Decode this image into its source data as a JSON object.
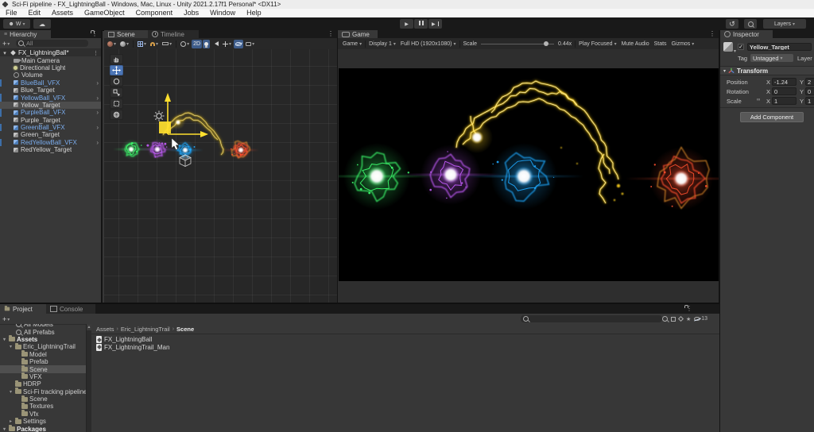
{
  "window": {
    "title": "Sci-Fi pipeline - FX_LightningBall - Windows, Mac, Linux - Unity 2021.2.17f1 Personal* <DX11>",
    "menu_items": [
      "File",
      "Edit",
      "Assets",
      "GameObject",
      "Component",
      "Jobs",
      "Window",
      "Help"
    ]
  },
  "toolbar": {
    "account_initial": "W",
    "layers_label": "Layers"
  },
  "hierarchy": {
    "tab_label": "Hierarchy",
    "search_text": "All",
    "items": [
      {
        "label": "FX_LightningBall*",
        "kind": "scene",
        "indent": 0
      },
      {
        "label": "Main Camera",
        "kind": "camera",
        "indent": 1
      },
      {
        "label": "Directional Light",
        "kind": "light",
        "indent": 1
      },
      {
        "label": "Volume",
        "kind": "volume",
        "indent": 1
      },
      {
        "label": "BlueBall_VFX",
        "kind": "prefab",
        "indent": 1,
        "chevron": true
      },
      {
        "label": "Blue_Target",
        "kind": "object",
        "indent": 1
      },
      {
        "label": "YellowBall_VFX",
        "kind": "prefab",
        "indent": 1,
        "chevron": true
      },
      {
        "label": "Yellow_Target",
        "kind": "object",
        "indent": 1,
        "selected": true
      },
      {
        "label": "PurpleBall_VFX",
        "kind": "prefab",
        "indent": 1,
        "chevron": true
      },
      {
        "label": "Purple_Target",
        "kind": "object",
        "indent": 1
      },
      {
        "label": "GreenBall_VFX",
        "kind": "prefab",
        "indent": 1,
        "chevron": true
      },
      {
        "label": "Green_Target",
        "kind": "object",
        "indent": 1
      },
      {
        "label": "RedYellowBall_VFX",
        "kind": "prefab",
        "indent": 1,
        "chevron": true
      },
      {
        "label": "RedYellow_Target",
        "kind": "object",
        "indent": 1
      }
    ]
  },
  "scene_panel": {
    "tabs": [
      {
        "label": "Scene"
      },
      {
        "label": "Timeline"
      }
    ],
    "mode_2d_label": "2D"
  },
  "game_panel": {
    "tab_label": "Game",
    "controls": {
      "mode": "Game",
      "display": "Display 1",
      "resolution": "Full HD (1920x1080)",
      "scale_label": "Scale",
      "scale_value": "0.44x",
      "play_focused": "Play Focused",
      "mute_audio": "Mute Audio",
      "stats": "Stats",
      "gizmos": "Gizmos"
    }
  },
  "inspector": {
    "tab_label": "Inspector",
    "object_name": "Yellow_Target",
    "tag_label": "Tag",
    "tag_value": "Untagged",
    "layer_label": "Layer",
    "transform_title": "Transform",
    "axis_x": "X",
    "axis_y": "Y",
    "rows": [
      {
        "label": "Position",
        "x": "-1.24",
        "y": "2"
      },
      {
        "label": "Rotation",
        "x": "0",
        "y": "0"
      },
      {
        "label": "Scale",
        "x": "1",
        "y": "1",
        "linked": true
      }
    ],
    "add_component_label": "Add Component"
  },
  "project": {
    "tab_label": "Project",
    "console_tab_label": "Console",
    "hidden_count": "13",
    "tree": [
      {
        "label": "All Models",
        "kind": "query",
        "indent": 1
      },
      {
        "label": "All Prefabs",
        "kind": "query",
        "indent": 1
      },
      {
        "label": "Assets",
        "kind": "folder",
        "indent": 0,
        "arrow": "open"
      },
      {
        "label": "Eric_LightningTrail",
        "kind": "folder",
        "indent": 1,
        "arrow": "open"
      },
      {
        "label": "Model",
        "kind": "folder",
        "indent": 2
      },
      {
        "label": "Prefab",
        "kind": "folder",
        "indent": 2
      },
      {
        "label": "Scene",
        "kind": "folder",
        "indent": 2,
        "selected": true
      },
      {
        "label": "VFX",
        "kind": "folder",
        "indent": 2
      },
      {
        "label": "HDRP",
        "kind": "folder",
        "indent": 1
      },
      {
        "label": "Sci-Fi tracking pipeline",
        "kind": "folder",
        "indent": 1,
        "arrow": "open"
      },
      {
        "label": "Scene",
        "kind": "folder",
        "indent": 2
      },
      {
        "label": "Textures",
        "kind": "folder",
        "indent": 2
      },
      {
        "label": "Vfx",
        "kind": "folder",
        "indent": 2
      },
      {
        "label": "Settings",
        "kind": "folder",
        "indent": 1,
        "arrow": "closed"
      },
      {
        "label": "Packages",
        "kind": "folder",
        "indent": 0,
        "arrow": "open"
      }
    ],
    "breadcrumb": [
      "Assets",
      "Eric_LightningTrail",
      "Scene"
    ],
    "files": [
      {
        "label": "FX_LightningBall"
      },
      {
        "label": "FX_LightningTrail_Man"
      }
    ]
  },
  "vfx": {
    "balls": [
      {
        "name": "green",
        "color": "#3dff6e"
      },
      {
        "name": "purple",
        "color": "#c65dff"
      },
      {
        "name": "blue",
        "color": "#1fa9ff"
      },
      {
        "name": "yellow",
        "color": "#ffd21e"
      },
      {
        "name": "red",
        "color": "#ff4f2e",
        "accent": "#ffa02e"
      }
    ]
  }
}
